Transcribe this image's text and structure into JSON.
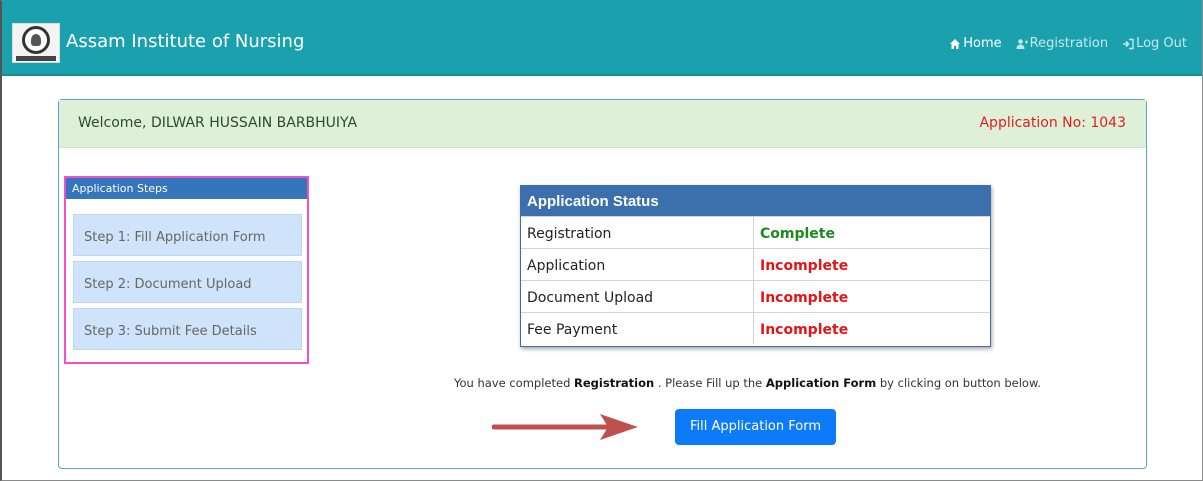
{
  "navbar": {
    "brand": "Assam Institute of Nursing",
    "links": [
      {
        "label": "Home",
        "icon": "home-icon"
      },
      {
        "label": "Registration",
        "icon": "user-plus-icon"
      },
      {
        "label": "Log Out",
        "icon": "sign-out-icon"
      }
    ],
    "bg_color": "#1ba1ae"
  },
  "panel": {
    "welcome": "Welcome, DILWAR HUSSAIN BARBHUIYA",
    "application_no": "Application No: 1043"
  },
  "steps": {
    "title": "Application Steps",
    "items": [
      "Step 1: Fill Application Form",
      "Step 2: Document Upload",
      "Step 3: Submit Fee Details"
    ]
  },
  "status": {
    "title": "Application Status",
    "rows": [
      {
        "label": "Registration",
        "value": "Complete",
        "state": "complete"
      },
      {
        "label": "Application",
        "value": "Incomplete",
        "state": "incomplete"
      },
      {
        "label": "Document Upload",
        "value": "Incomplete",
        "state": "incomplete"
      },
      {
        "label": "Fee Payment",
        "value": "Incomplete",
        "state": "incomplete"
      }
    ]
  },
  "message": {
    "part1": "You have completed ",
    "bold1": "Registration",
    "part2": " . Please Fill up the ",
    "bold2": "Application Form",
    "part3": " by clicking on button below."
  },
  "button": {
    "label": "Fill Application Form",
    "color": "#0d7bf7"
  },
  "colors": {
    "complete": "#1c8a1c",
    "incomplete": "#e61414",
    "arrow": "#c0504d"
  }
}
